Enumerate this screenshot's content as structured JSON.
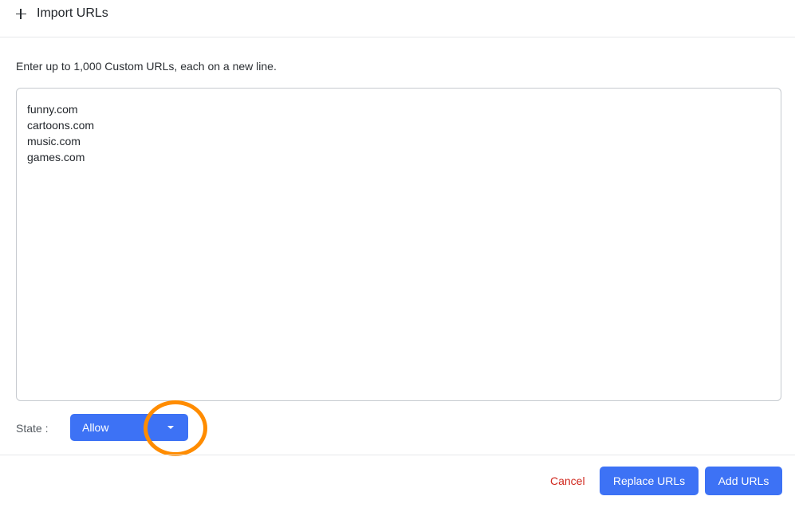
{
  "header": {
    "title": "Import URLs",
    "icon": "plus-icon"
  },
  "instructions": "Enter up to 1,000 Custom URLs, each on a new line.",
  "url_input": {
    "value": "funny.com\ncartoons.com\nmusic.com\ngames.com"
  },
  "state": {
    "label": "State :",
    "selected": "Allow",
    "icon": "chevron-down-icon"
  },
  "actions": {
    "cancel_label": "Cancel",
    "replace_label": "Replace URLs",
    "add_label": "Add URLs"
  },
  "colors": {
    "primary": "#3d72f5",
    "cancel": "#d0271d",
    "highlight": "#ff8c00"
  }
}
